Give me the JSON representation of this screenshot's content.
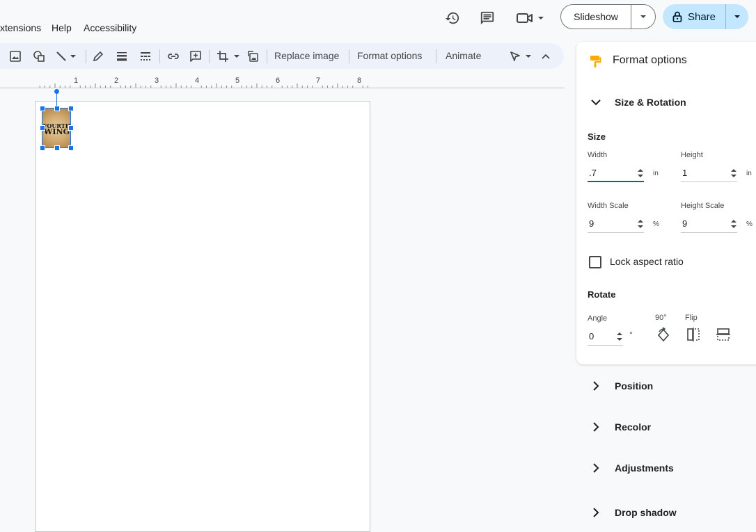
{
  "menu": {
    "items": [
      "xtensions",
      "Help",
      "Accessibility"
    ]
  },
  "topbar": {
    "slideshow_label": "Slideshow",
    "share_label": "Share",
    "icons": [
      "history-icon",
      "comment-icon",
      "meet-icon"
    ]
  },
  "toolbar": {
    "replace_image": "Replace image",
    "format_options": "Format options",
    "animate": "Animate"
  },
  "ruler": {
    "numbers": [
      "1",
      "2",
      "3",
      "4",
      "5",
      "6",
      "7",
      "8"
    ]
  },
  "slide_image": {
    "line1": "FOURTH",
    "line2": "WING"
  },
  "panel": {
    "title": "Format options",
    "size_rotation": {
      "title": "Size & Rotation",
      "size_label": "Size",
      "width_label": "Width",
      "width_value": ".7",
      "width_unit": "in",
      "height_label": "Height",
      "height_value": "1",
      "height_unit": "in",
      "width_scale_label": "Width Scale",
      "width_scale_value": "9",
      "width_scale_unit": "%",
      "height_scale_label": "Height Scale",
      "height_scale_value": "9",
      "height_scale_unit": "%",
      "lock_label": "Lock aspect ratio",
      "rotate_label": "Rotate",
      "angle_label": "Angle",
      "angle_value": "0",
      "angle_unit": "°",
      "rotate90_label": "90°",
      "flip_label": "Flip"
    },
    "sections": [
      "Position",
      "Recolor",
      "Adjustments",
      "Drop shadow"
    ]
  },
  "colors": {
    "accent": "#1a73e8",
    "share_bg": "#c2e7ff",
    "toolbar_bg": "#edf2fa"
  }
}
